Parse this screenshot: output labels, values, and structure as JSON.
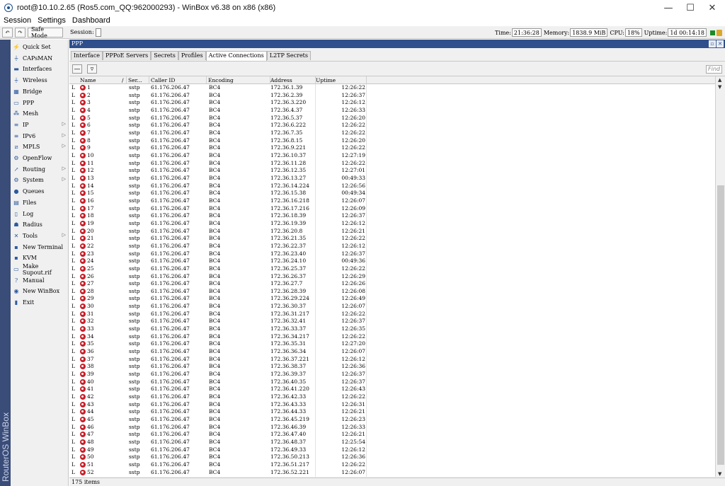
{
  "window": {
    "title": "root@10.10.2.65 (Ros5.com_QQ:962000293) - WinBox v6.38 on x86 (x86)"
  },
  "menubar": {
    "items": [
      "Session",
      "Settings",
      "Dashboard"
    ]
  },
  "toolbar": {
    "safe_mode": "Safe Mode",
    "session_label": "Session:",
    "time_label": "Time:",
    "time": "21:36:28",
    "memory_label": "Memory:",
    "memory": "1838.9 MiB",
    "cpu_label": "CPU:",
    "cpu": "18%",
    "uptime_label": "Uptime:",
    "uptime": "1d 00:14:18"
  },
  "brand": "RouterOS WinBox",
  "sidebar": {
    "items": [
      {
        "label": "Quick Set",
        "icon": "quickset-icon",
        "glyph": "⚡",
        "arrow": false
      },
      {
        "label": "CAPsMAN",
        "icon": "capsman-icon",
        "glyph": "⏚",
        "arrow": false
      },
      {
        "label": "Interfaces",
        "icon": "interfaces-icon",
        "glyph": "▬",
        "arrow": false
      },
      {
        "label": "Wireless",
        "icon": "wireless-icon",
        "glyph": "⏚",
        "arrow": false
      },
      {
        "label": "Bridge",
        "icon": "bridge-icon",
        "glyph": "▦",
        "arrow": false
      },
      {
        "label": "PPP",
        "icon": "ppp-icon",
        "glyph": "▭",
        "arrow": false
      },
      {
        "label": "Mesh",
        "icon": "mesh-icon",
        "glyph": "⁂",
        "arrow": false
      },
      {
        "label": "IP",
        "icon": "ip-icon",
        "glyph": "≡",
        "arrow": true
      },
      {
        "label": "IPv6",
        "icon": "ipv6-icon",
        "glyph": "≡",
        "arrow": true
      },
      {
        "label": "MPLS",
        "icon": "mpls-icon",
        "glyph": "⧄",
        "arrow": true
      },
      {
        "label": "OpenFlow",
        "icon": "openflow-icon",
        "glyph": "⚙",
        "arrow": false
      },
      {
        "label": "Routing",
        "icon": "routing-icon",
        "glyph": "↗",
        "arrow": true
      },
      {
        "label": "System",
        "icon": "system-icon",
        "glyph": "⚙",
        "arrow": true
      },
      {
        "label": "Queues",
        "icon": "queues-icon",
        "glyph": "●",
        "arrow": false
      },
      {
        "label": "Files",
        "icon": "files-icon",
        "glyph": "▤",
        "arrow": false
      },
      {
        "label": "Log",
        "icon": "log-icon",
        "glyph": "▯",
        "arrow": false
      },
      {
        "label": "Radius",
        "icon": "radius-icon",
        "glyph": "☗",
        "arrow": false
      },
      {
        "label": "Tools",
        "icon": "tools-icon",
        "glyph": "✕",
        "arrow": true
      },
      {
        "label": "New Terminal",
        "icon": "terminal-icon",
        "glyph": "▪",
        "arrow": false
      },
      {
        "label": "KVM",
        "icon": "kvm-icon",
        "glyph": "▪",
        "arrow": false
      },
      {
        "label": "Make Supout.rif",
        "icon": "supout-icon",
        "glyph": "▭",
        "arrow": false
      },
      {
        "label": "Manual",
        "icon": "manual-icon",
        "glyph": "?",
        "arrow": false
      },
      {
        "label": "New WinBox",
        "icon": "winbox-icon",
        "glyph": "◉",
        "arrow": false
      },
      {
        "label": "Exit",
        "icon": "exit-icon",
        "glyph": "▮",
        "arrow": false
      }
    ]
  },
  "ppp": {
    "title": "PPP",
    "tabs": [
      "Interface",
      "PPPoE Servers",
      "Secrets",
      "Profiles",
      "Active Connections",
      "L2TP Secrets"
    ],
    "active_tab": 4,
    "find_placeholder": "Find",
    "columns": [
      "Name",
      "Ser...",
      "Caller ID",
      "Encoding",
      "Address",
      "Uptime"
    ],
    "flag": "L",
    "service": "sstp",
    "caller_id": "61.176.206.47",
    "encoding": "BC4",
    "rows": [
      [
        "1",
        "172.36.1.39",
        "12:26:22"
      ],
      [
        "2",
        "172.36.2.39",
        "12:26:37"
      ],
      [
        "3",
        "172.36.3.220",
        "12:26:12"
      ],
      [
        "4",
        "172.36.4.37",
        "12:26:33"
      ],
      [
        "5",
        "172.36.5.37",
        "12:26:20"
      ],
      [
        "6",
        "172.36.6.222",
        "12:26:22"
      ],
      [
        "7",
        "172.36.7.35",
        "12:26:22"
      ],
      [
        "8",
        "172.36.8.15",
        "12:26:20"
      ],
      [
        "9",
        "172.36.9.221",
        "12:26:22"
      ],
      [
        "10",
        "172.36.10.37",
        "12:27:19"
      ],
      [
        "11",
        "172.36.11.28",
        "12:26:22"
      ],
      [
        "12",
        "172.36.12.35",
        "12:27:01"
      ],
      [
        "13",
        "172.36.13.27",
        "00:49:33"
      ],
      [
        "14",
        "172.36.14.224",
        "12:26:56"
      ],
      [
        "15",
        "172.36.15.38",
        "00:49:34"
      ],
      [
        "16",
        "172.36.16.218",
        "12:26:07"
      ],
      [
        "17",
        "172.36.17.216",
        "12:26:09"
      ],
      [
        "18",
        "172.36.18.39",
        "12:26:37"
      ],
      [
        "19",
        "172.36.19.39",
        "12:26:12"
      ],
      [
        "20",
        "172.36.20.8",
        "12:26:21"
      ],
      [
        "21",
        "172.36.21.35",
        "12:26:22"
      ],
      [
        "22",
        "172.36.22.37",
        "12:26:12"
      ],
      [
        "23",
        "172.36.23.40",
        "12:26:37"
      ],
      [
        "24",
        "172.36.24.10",
        "00:49:36"
      ],
      [
        "25",
        "172.36.25.37",
        "12:26:22"
      ],
      [
        "26",
        "172.36.26.37",
        "12:26:29"
      ],
      [
        "27",
        "172.36.27.7",
        "12:26:26"
      ],
      [
        "28",
        "172.36.28.39",
        "12:26:08"
      ],
      [
        "29",
        "172.36.29.224",
        "12:26:49"
      ],
      [
        "30",
        "172.36.30.37",
        "12:26:07"
      ],
      [
        "31",
        "172.36.31.217",
        "12:26:22"
      ],
      [
        "32",
        "172.36.32.41",
        "12:26:37"
      ],
      [
        "33",
        "172.36.33.37",
        "12:26:35"
      ],
      [
        "34",
        "172.36.34.217",
        "12:26:22"
      ],
      [
        "35",
        "172.36.35.31",
        "12:27:20"
      ],
      [
        "36",
        "172.36.36.34",
        "12:26:07"
      ],
      [
        "37",
        "172.36.37.221",
        "12:26:12"
      ],
      [
        "38",
        "172.36.38.37",
        "12:26:36"
      ],
      [
        "39",
        "172.36.39.37",
        "12:26:37"
      ],
      [
        "40",
        "172.36.40.35",
        "12:26:37"
      ],
      [
        "41",
        "172.36.41.220",
        "12:26:43"
      ],
      [
        "42",
        "172.36.42.33",
        "12:26:22"
      ],
      [
        "43",
        "172.36.43.33",
        "12:26:31"
      ],
      [
        "44",
        "172.36.44.33",
        "12:26:21"
      ],
      [
        "45",
        "172.36.45.219",
        "12:26:23"
      ],
      [
        "46",
        "172.36.46.39",
        "12:26:33"
      ],
      [
        "47",
        "172.36.47.40",
        "12:26:21"
      ],
      [
        "48",
        "172.36.48.37",
        "12:25:54"
      ],
      [
        "49",
        "172.36.49.33",
        "12:26:12"
      ],
      [
        "50",
        "172.36.50.213",
        "12:26:36"
      ],
      [
        "51",
        "172.36.51.217",
        "12:26:22"
      ],
      [
        "52",
        "172.36.52.221",
        "12:26:07"
      ]
    ],
    "status": "175 items"
  }
}
